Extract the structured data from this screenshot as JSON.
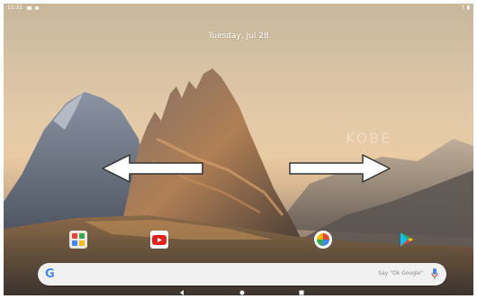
{
  "status_bar": {
    "time": "11:31",
    "right_icons": "↑ ▮"
  },
  "lock": {
    "date": "Tuesday, Jul 28"
  },
  "wallpaper": {
    "watermark": "KOBE"
  },
  "dock": {
    "apps": [
      {
        "icon": "apps-folder-icon"
      },
      {
        "icon": "youtube-icon"
      },
      {
        "icon": "photos-icon"
      },
      {
        "icon": "play-store-icon"
      }
    ]
  },
  "search": {
    "hint": "Say \"Ok Google\"",
    "logo": "G"
  },
  "colors": {
    "arrow": "#ffffff",
    "youtube_red": "#e62117",
    "google_blue": "#4285f4",
    "search_bg": "#f1f1f1"
  }
}
